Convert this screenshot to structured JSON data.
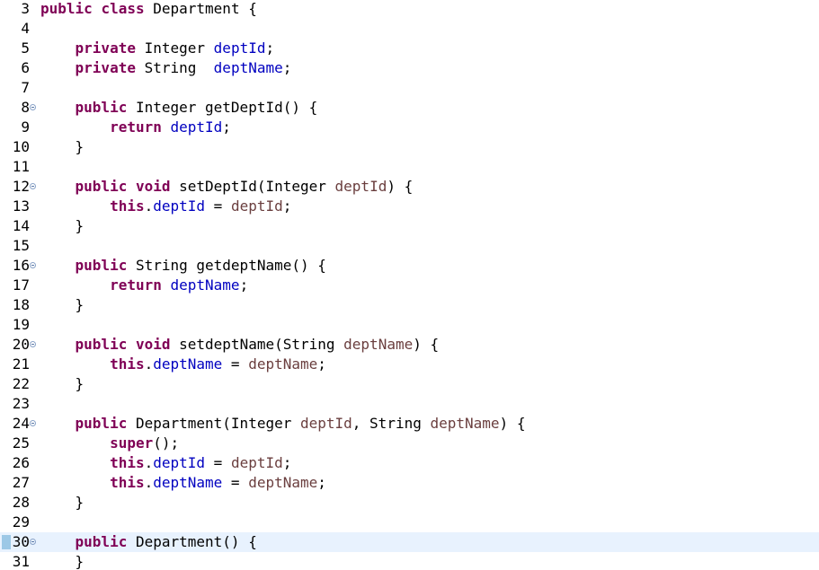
{
  "lines": [
    {
      "num": "3",
      "fold": false,
      "current": false,
      "tokens": [
        [
          "kw",
          "public"
        ],
        [
          "pln",
          " "
        ],
        [
          "kw",
          "class"
        ],
        [
          "pln",
          " Department {"
        ]
      ]
    },
    {
      "num": "4",
      "fold": false,
      "current": false,
      "tokens": []
    },
    {
      "num": "5",
      "fold": false,
      "current": false,
      "tokens": [
        [
          "pln",
          "    "
        ],
        [
          "kw",
          "private"
        ],
        [
          "pln",
          " Integer "
        ],
        [
          "fld",
          "deptId"
        ],
        [
          "pln",
          ";"
        ]
      ]
    },
    {
      "num": "6",
      "fold": false,
      "current": false,
      "tokens": [
        [
          "pln",
          "    "
        ],
        [
          "kw",
          "private"
        ],
        [
          "pln",
          " String  "
        ],
        [
          "fld",
          "deptName"
        ],
        [
          "pln",
          ";"
        ]
      ]
    },
    {
      "num": "7",
      "fold": false,
      "current": false,
      "tokens": []
    },
    {
      "num": "8",
      "fold": true,
      "current": false,
      "tokens": [
        [
          "pln",
          "    "
        ],
        [
          "kw",
          "public"
        ],
        [
          "pln",
          " Integer getDeptId() {"
        ]
      ]
    },
    {
      "num": "9",
      "fold": false,
      "current": false,
      "tokens": [
        [
          "pln",
          "        "
        ],
        [
          "kw",
          "return"
        ],
        [
          "pln",
          " "
        ],
        [
          "fld",
          "deptId"
        ],
        [
          "pln",
          ";"
        ]
      ]
    },
    {
      "num": "10",
      "fold": false,
      "current": false,
      "tokens": [
        [
          "pln",
          "    }"
        ]
      ]
    },
    {
      "num": "11",
      "fold": false,
      "current": false,
      "tokens": []
    },
    {
      "num": "12",
      "fold": true,
      "current": false,
      "tokens": [
        [
          "pln",
          "    "
        ],
        [
          "kw",
          "public"
        ],
        [
          "pln",
          " "
        ],
        [
          "kw",
          "void"
        ],
        [
          "pln",
          " setDeptId(Integer "
        ],
        [
          "param",
          "deptId"
        ],
        [
          "pln",
          ") {"
        ]
      ]
    },
    {
      "num": "13",
      "fold": false,
      "current": false,
      "tokens": [
        [
          "pln",
          "        "
        ],
        [
          "kw",
          "this"
        ],
        [
          "pln",
          "."
        ],
        [
          "fld",
          "deptId"
        ],
        [
          "pln",
          " = "
        ],
        [
          "param",
          "deptId"
        ],
        [
          "pln",
          ";"
        ]
      ]
    },
    {
      "num": "14",
      "fold": false,
      "current": false,
      "tokens": [
        [
          "pln",
          "    }"
        ]
      ]
    },
    {
      "num": "15",
      "fold": false,
      "current": false,
      "tokens": []
    },
    {
      "num": "16",
      "fold": true,
      "current": false,
      "tokens": [
        [
          "pln",
          "    "
        ],
        [
          "kw",
          "public"
        ],
        [
          "pln",
          " String getdeptName() {"
        ]
      ]
    },
    {
      "num": "17",
      "fold": false,
      "current": false,
      "tokens": [
        [
          "pln",
          "        "
        ],
        [
          "kw",
          "return"
        ],
        [
          "pln",
          " "
        ],
        [
          "fld",
          "deptName"
        ],
        [
          "pln",
          ";"
        ]
      ]
    },
    {
      "num": "18",
      "fold": false,
      "current": false,
      "tokens": [
        [
          "pln",
          "    }"
        ]
      ]
    },
    {
      "num": "19",
      "fold": false,
      "current": false,
      "tokens": []
    },
    {
      "num": "20",
      "fold": true,
      "current": false,
      "tokens": [
        [
          "pln",
          "    "
        ],
        [
          "kw",
          "public"
        ],
        [
          "pln",
          " "
        ],
        [
          "kw",
          "void"
        ],
        [
          "pln",
          " setdeptName(String "
        ],
        [
          "param",
          "deptName"
        ],
        [
          "pln",
          ") {"
        ]
      ]
    },
    {
      "num": "21",
      "fold": false,
      "current": false,
      "tokens": [
        [
          "pln",
          "        "
        ],
        [
          "kw",
          "this"
        ],
        [
          "pln",
          "."
        ],
        [
          "fld",
          "deptName"
        ],
        [
          "pln",
          " = "
        ],
        [
          "param",
          "deptName"
        ],
        [
          "pln",
          ";"
        ]
      ]
    },
    {
      "num": "22",
      "fold": false,
      "current": false,
      "tokens": [
        [
          "pln",
          "    }"
        ]
      ]
    },
    {
      "num": "23",
      "fold": false,
      "current": false,
      "tokens": []
    },
    {
      "num": "24",
      "fold": true,
      "current": false,
      "tokens": [
        [
          "pln",
          "    "
        ],
        [
          "kw",
          "public"
        ],
        [
          "pln",
          " Department(Integer "
        ],
        [
          "param",
          "deptId"
        ],
        [
          "pln",
          ", String "
        ],
        [
          "param",
          "deptName"
        ],
        [
          "pln",
          ") {"
        ]
      ]
    },
    {
      "num": "25",
      "fold": false,
      "current": false,
      "tokens": [
        [
          "pln",
          "        "
        ],
        [
          "kw",
          "super"
        ],
        [
          "pln",
          "();"
        ]
      ]
    },
    {
      "num": "26",
      "fold": false,
      "current": false,
      "tokens": [
        [
          "pln",
          "        "
        ],
        [
          "kw",
          "this"
        ],
        [
          "pln",
          "."
        ],
        [
          "fld",
          "deptId"
        ],
        [
          "pln",
          " = "
        ],
        [
          "param",
          "deptId"
        ],
        [
          "pln",
          ";"
        ]
      ]
    },
    {
      "num": "27",
      "fold": false,
      "current": false,
      "tokens": [
        [
          "pln",
          "        "
        ],
        [
          "kw",
          "this"
        ],
        [
          "pln",
          "."
        ],
        [
          "fld",
          "deptName"
        ],
        [
          "pln",
          " = "
        ],
        [
          "param",
          "deptName"
        ],
        [
          "pln",
          ";"
        ]
      ]
    },
    {
      "num": "28",
      "fold": false,
      "current": false,
      "tokens": [
        [
          "pln",
          "    }"
        ]
      ]
    },
    {
      "num": "29",
      "fold": false,
      "current": false,
      "tokens": []
    },
    {
      "num": "30",
      "fold": true,
      "current": true,
      "tokens": [
        [
          "pln",
          "    "
        ],
        [
          "kw",
          "public"
        ],
        [
          "pln",
          " Department() {"
        ]
      ]
    },
    {
      "num": "31",
      "fold": false,
      "current": false,
      "tokens": [
        [
          "pln",
          "    }"
        ]
      ]
    }
  ]
}
